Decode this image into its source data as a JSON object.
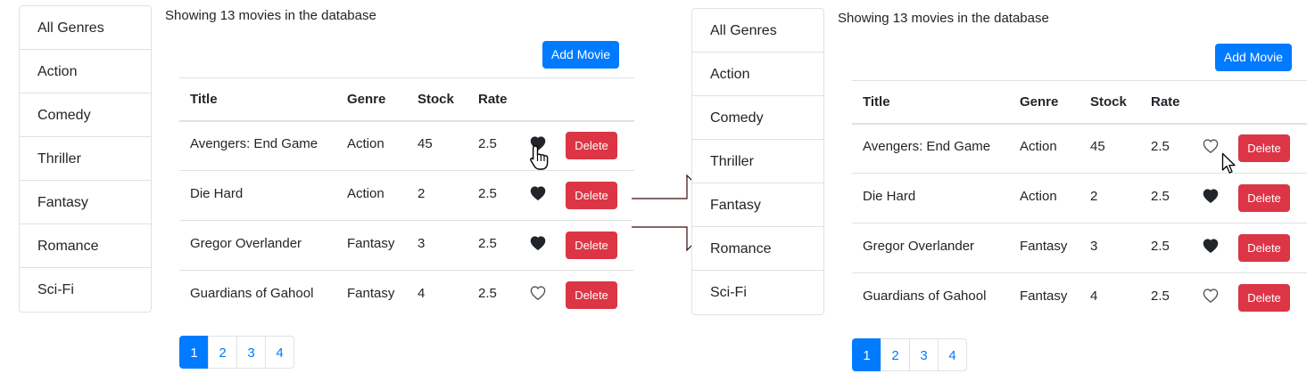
{
  "screens": [
    {
      "showing_text": "Showing 13 movies in the database",
      "add_movie_label": "Add Movie",
      "genres": [
        "All Genres",
        "Action",
        "Comedy",
        "Thriller",
        "Fantasy",
        "Romance",
        "Sci-Fi"
      ],
      "table": {
        "headers": [
          "Title",
          "Genre",
          "Stock",
          "Rate"
        ],
        "rows": [
          {
            "title": "Avengers: End Game",
            "genre": "Action",
            "stock": "45",
            "rate": "2.5",
            "liked": true
          },
          {
            "title": "Die Hard",
            "genre": "Action",
            "stock": "2",
            "rate": "2.5",
            "liked": true
          },
          {
            "title": "Gregor Overlander",
            "genre": "Fantasy",
            "stock": "3",
            "rate": "2.5",
            "liked": true
          },
          {
            "title": "Guardians of Gahool",
            "genre": "Fantasy",
            "stock": "4",
            "rate": "2.5",
            "liked": false
          }
        ],
        "delete_label": "Delete"
      },
      "pages": [
        "1",
        "2",
        "3",
        "4"
      ],
      "active_page": "1",
      "cursor": "hand-pointer-icon"
    },
    {
      "showing_text": "Showing 13 movies in the database",
      "add_movie_label": "Add Movie",
      "genres": [
        "All Genres",
        "Action",
        "Comedy",
        "Thriller",
        "Fantasy",
        "Romance",
        "Sci-Fi"
      ],
      "table": {
        "headers": [
          "Title",
          "Genre",
          "Stock",
          "Rate"
        ],
        "rows": [
          {
            "title": "Avengers: End Game",
            "genre": "Action",
            "stock": "45",
            "rate": "2.5",
            "liked": false
          },
          {
            "title": "Die Hard",
            "genre": "Action",
            "stock": "2",
            "rate": "2.5",
            "liked": true
          },
          {
            "title": "Gregor Overlander",
            "genre": "Fantasy",
            "stock": "3",
            "rate": "2.5",
            "liked": true
          },
          {
            "title": "Guardians of Gahool",
            "genre": "Fantasy",
            "stock": "4",
            "rate": "2.5",
            "liked": false
          }
        ],
        "delete_label": "Delete"
      },
      "pages": [
        "1",
        "2",
        "3",
        "4"
      ],
      "active_page": "1",
      "cursor": "arrow-pointer-icon"
    }
  ],
  "transition_icon": "right-arrow-icon",
  "colors": {
    "primary": "#007bff",
    "danger": "#dc3545",
    "border": "#dee2e6",
    "text": "#212529"
  }
}
